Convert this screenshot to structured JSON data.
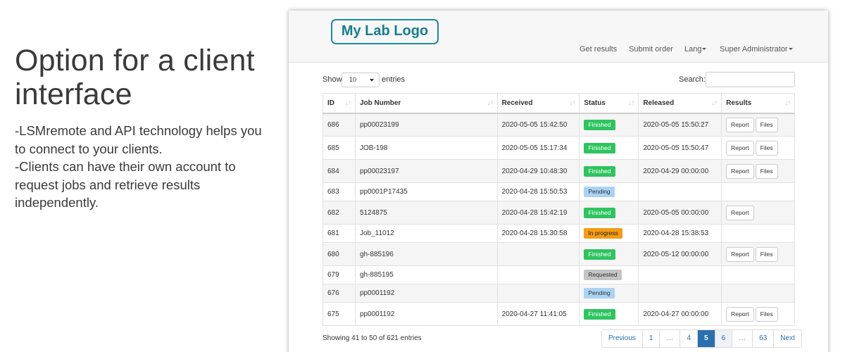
{
  "promo": {
    "title_line1": "Option for a client",
    "title_line2": "interface",
    "lines": [
      "-LSMremote and API technology helps you",
      "to connect to your clients.",
      "-Clients can have their own account to",
      "request jobs and retrieve results",
      "independently."
    ]
  },
  "header": {
    "logo": "My Lab Logo",
    "nav": {
      "get_results": "Get results",
      "submit_order": "Submit order",
      "lang": "Lang",
      "user": "Super Administrator"
    }
  },
  "controls": {
    "show_label": "Show",
    "entries_select": "10",
    "entries_label": "entries",
    "search_label": "Search:",
    "search_value": ""
  },
  "table": {
    "columns": [
      "ID",
      "Job Number",
      "Received",
      "Status",
      "Released",
      "Results"
    ],
    "rows": [
      {
        "id": "686",
        "job": "pp00023199",
        "received": "2020-05-05 15:42:50",
        "status": "Finished",
        "released": "2020-05-05 15:50:27",
        "report": "Report",
        "files": "Files"
      },
      {
        "id": "685",
        "job": "JOB-198",
        "received": "2020-05-05 15:17:34",
        "status": "Finished",
        "released": "2020-05-05 15:50:47",
        "report": "Report",
        "files": "Files"
      },
      {
        "id": "684",
        "job": "pp00023197",
        "received": "2020-04-29 10:48:30",
        "status": "Finished",
        "released": "2020-04-29 00:00:00",
        "report": "Report",
        "files": "Files"
      },
      {
        "id": "683",
        "job": "pp0001P17435",
        "received": "2020-04-28 15:50:53",
        "status": "Pending",
        "released": "",
        "report": "",
        "files": ""
      },
      {
        "id": "682",
        "job": "5124875",
        "received": "2020-04-28 15:42:19",
        "status": "Finished",
        "released": "2020-05-05 00:00:00",
        "report": "Report",
        "files": ""
      },
      {
        "id": "681",
        "job": "Job_11012",
        "received": "2020-04-28 15:30:58",
        "status": "In progress",
        "released": "2020-04-28 15:38:53",
        "report": "",
        "files": ""
      },
      {
        "id": "680",
        "job": "gh-885196",
        "received": "",
        "status": "Finished",
        "released": "2020-05-12 00:00:00",
        "report": "Report",
        "files": "Files"
      },
      {
        "id": "679",
        "job": "gh-885195",
        "received": "",
        "status": "Requested",
        "released": "",
        "report": "",
        "files": ""
      },
      {
        "id": "676",
        "job": "pp0001192",
        "received": "",
        "status": "Pending",
        "released": "",
        "report": "",
        "files": ""
      },
      {
        "id": "675",
        "job": "pp0001192",
        "received": "2020-04-27 11:41:05",
        "status": "Finished",
        "released": "2020-04-27 00:00:00",
        "report": "Report",
        "files": "Files"
      }
    ]
  },
  "footer": {
    "showing": "Showing 41 to 50 of 621 entries",
    "pagination": [
      "Previous",
      "1",
      "…",
      "4",
      "5",
      "6",
      "…",
      "63",
      "Next"
    ],
    "active_page": "5"
  },
  "colors": {
    "finished": "#2ec45f",
    "pending": "#a9d3f5",
    "in_progress": "#f59b16",
    "requested": "#c4c4c4",
    "logo": "#137e8f",
    "link": "#2a6fb0"
  }
}
